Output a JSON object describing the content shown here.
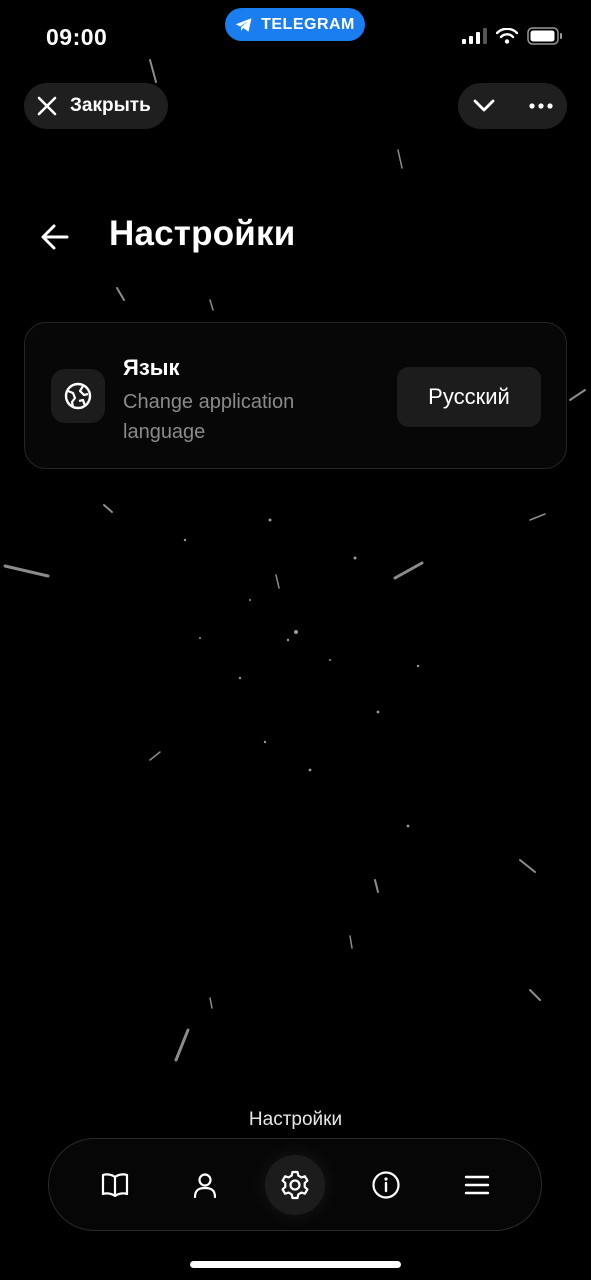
{
  "status_bar": {
    "time": "09:00",
    "pill_label": "TELEGRAM",
    "icons": [
      "signal-icon",
      "wifi-icon",
      "battery-icon"
    ]
  },
  "top_bar": {
    "close_label": "Закрыть",
    "icons": [
      "close-icon",
      "chevron-down-icon",
      "more-icon"
    ]
  },
  "header": {
    "title": "Настройки"
  },
  "language_setting": {
    "title": "Язык",
    "subtitle": "Change application language",
    "value": "Русский",
    "icon": "globe-icon"
  },
  "bottom_nav": {
    "active_label": "Настройки",
    "items": [
      {
        "icon": "book-icon",
        "active": false
      },
      {
        "icon": "profile-icon",
        "active": false
      },
      {
        "icon": "gear-icon",
        "active": true
      },
      {
        "icon": "info-icon",
        "active": false
      },
      {
        "icon": "menu-icon",
        "active": false
      }
    ]
  },
  "colors": {
    "background": "#000000",
    "telegram_accent": "#1a7df0",
    "secondary_text": "#8a8a8a",
    "surface": "#1c1c1c"
  }
}
